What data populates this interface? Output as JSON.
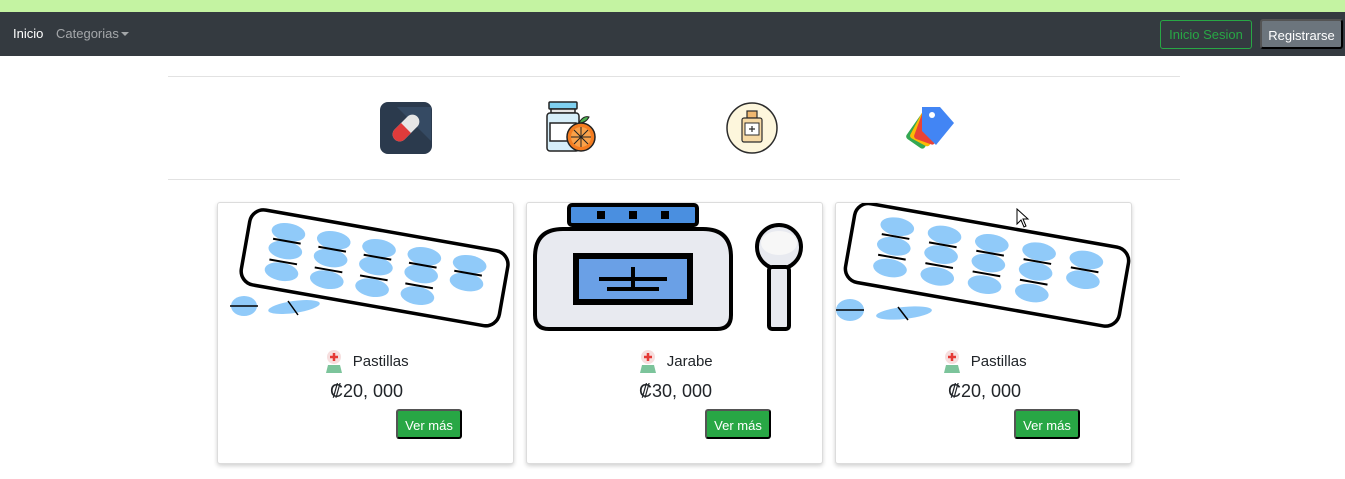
{
  "navbar": {
    "home_label": "Inicio",
    "categories_label": "Categorias",
    "login_label": "Inicio Sesion",
    "register_label": "Registrarse"
  },
  "categories": [
    {
      "icon": "pill-capsule-icon"
    },
    {
      "icon": "vitamin-jar-orange-icon"
    },
    {
      "icon": "perfume-bottle-icon"
    },
    {
      "icon": "tags-icon"
    }
  ],
  "products": [
    {
      "name": "Pastillas",
      "price": "₡20, 000",
      "button": "Ver más",
      "image": "pill-blister-pack-image"
    },
    {
      "name": "Jarabe",
      "price": "₡30, 000",
      "button": "Ver más",
      "image": "syrup-bottle-image"
    },
    {
      "name": "Pastillas",
      "price": "₡20, 000",
      "button": "Ver más",
      "image": "pill-blister-pack-image"
    }
  ],
  "colors": {
    "navbar_bg": "#343a40",
    "top_strip": "#c4f3a2",
    "success": "#28a745",
    "secondary": "#6c757d",
    "pill_blue": "#90caf9"
  }
}
